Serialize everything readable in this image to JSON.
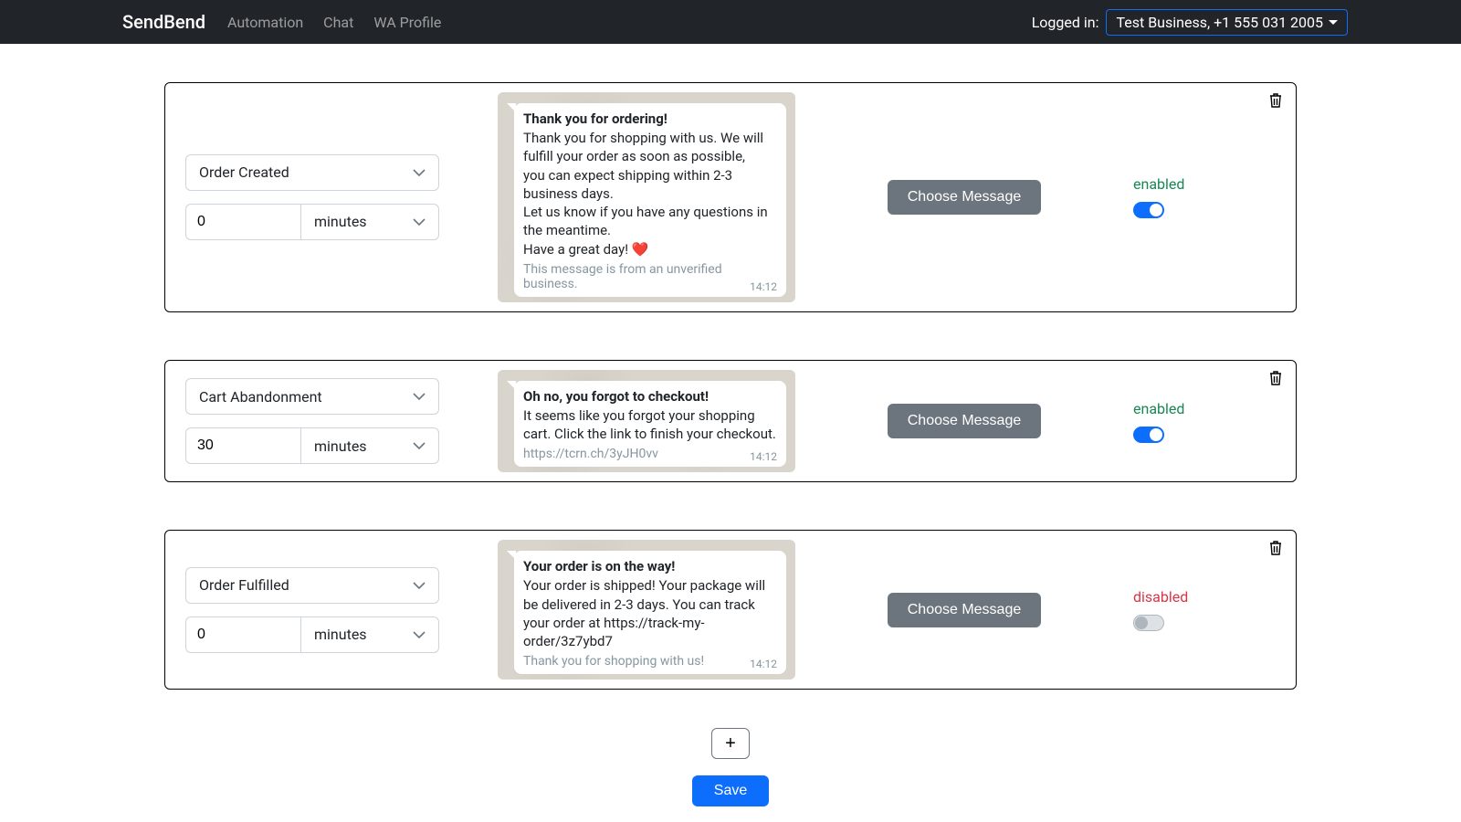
{
  "nav": {
    "brand": "SendBend",
    "links": [
      "Automation",
      "Chat",
      "WA Profile"
    ],
    "logged_in_label": "Logged in:",
    "account": "Test Business, +1 555 031 2005"
  },
  "rules": [
    {
      "trigger": "Order Created",
      "delay_value": "0",
      "delay_unit": "minutes",
      "message": {
        "title": "Thank you for ordering!",
        "body": "Thank you for shopping with us. We will fulfill your order as soon as possible,\nyou can expect shipping within 2-3 business days.\nLet us know if you have any questions in the meantime.\nHave a great day! ❤️",
        "footer": "This message is from an unverified business.",
        "link": "",
        "time": "14:12"
      },
      "choose_label": "Choose Message",
      "enabled": true,
      "status_label": "enabled"
    },
    {
      "trigger": "Cart Abandonment",
      "delay_value": "30",
      "delay_unit": "minutes",
      "message": {
        "title": "Oh no, you forgot to checkout!",
        "body": "It seems like you forgot your shopping cart. Click the link to finish your checkout.",
        "footer": "",
        "link": "https://tcrn.ch/3yJH0vv",
        "time": "14:12"
      },
      "choose_label": "Choose Message",
      "enabled": true,
      "status_label": "enabled"
    },
    {
      "trigger": "Order Fulfilled",
      "delay_value": "0",
      "delay_unit": "minutes",
      "message": {
        "title": "Your order is on the way!",
        "body": "Your order is shipped! Your package will be delivered in 2-3 days. You can track your order at https://track-my-order/3z7ybd7",
        "footer": "Thank you for shopping with us!",
        "link": "",
        "time": "14:12"
      },
      "choose_label": "Choose Message",
      "enabled": false,
      "status_label": "disabled"
    }
  ],
  "buttons": {
    "add": "+",
    "save": "Save"
  }
}
